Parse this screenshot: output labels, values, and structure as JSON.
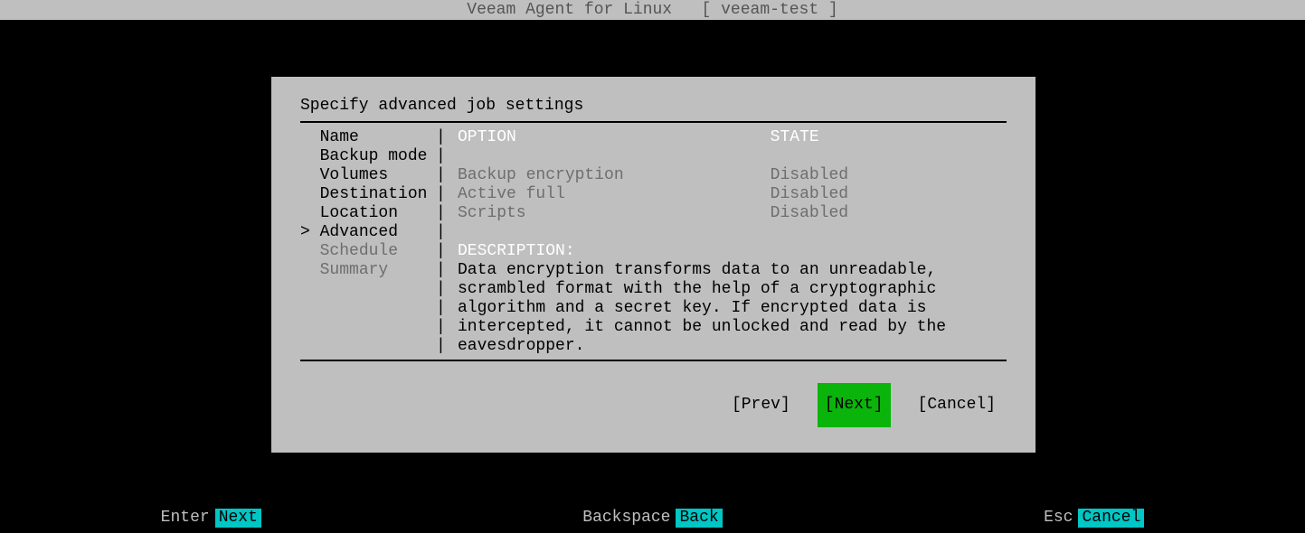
{
  "titlebar": "Veeam Agent for Linux   [ veeam-test ]",
  "dialog": {
    "title": "Specify advanced job settings",
    "sidebar": [
      {
        "label": "Name",
        "style": "side-done",
        "selected": false
      },
      {
        "label": "Backup mode",
        "style": "side-done",
        "selected": false
      },
      {
        "label": "Volumes",
        "style": "side-done",
        "selected": false
      },
      {
        "label": "Destination",
        "style": "side-done",
        "selected": false
      },
      {
        "label": "Location",
        "style": "side-done",
        "selected": false
      },
      {
        "label": "Advanced",
        "style": "side-active",
        "selected": true
      },
      {
        "label": "Schedule",
        "style": "side-later",
        "selected": false
      },
      {
        "label": "Summary",
        "style": "side-later",
        "selected": false
      }
    ],
    "headers": {
      "option": "OPTION",
      "state": "STATE"
    },
    "options": [
      {
        "name": "Backup encryption",
        "state": "Disabled",
        "selected": true
      },
      {
        "name": "Active full",
        "state": "Disabled",
        "selected": false
      },
      {
        "name": "Scripts",
        "state": "Disabled",
        "selected": false
      }
    ],
    "description_label": "DESCRIPTION:",
    "description": "Data encryption transforms data to an unreadable, scrambled format with the help of a cryptographic algorithm and a secret key. If encrypted data is intercepted, it cannot be unlocked and read by the eavesdropper.",
    "buttons": {
      "prev": "[Prev]",
      "next": "[Next]",
      "cancel": "[Cancel]"
    }
  },
  "hints": {
    "enter_label": "Enter",
    "enter_key": "Next",
    "backspace_label": "Backspace",
    "backspace_key": "Back",
    "esc_label": "Esc",
    "esc_key": "Cancel"
  }
}
